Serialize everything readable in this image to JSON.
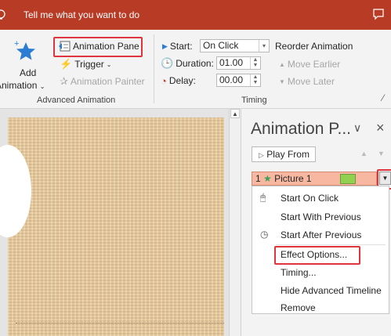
{
  "titlebar": {
    "tell_me": "Tell me what you want to do"
  },
  "ribbon": {
    "add_animation": {
      "line1": "Add",
      "line2": "Animation"
    },
    "animation_pane_label": "Animation Pane",
    "trigger_label": "Trigger",
    "animation_painter_label": "Animation Painter",
    "advanced_group_label": "Advanced Animation",
    "start_label": "Start:",
    "start_value": "On Click",
    "duration_label": "Duration:",
    "duration_value": "01.00",
    "delay_label": "Delay:",
    "delay_value": "00.00",
    "timing_group_label": "Timing",
    "reorder_label": "Reorder Animation",
    "move_earlier_label": "Move Earlier",
    "move_later_label": "Move Later"
  },
  "pane": {
    "title": "Animation P...",
    "play_from_label": "Play From",
    "item": {
      "number": "1",
      "name": "Picture 1"
    }
  },
  "menu": {
    "start_on_click": "Start On Click",
    "start_with_previous": "Start With Previous",
    "start_after_previous": "Start After Previous",
    "effect_options": "Effect Options...",
    "timing": "Timing...",
    "hide_advanced_timeline": "Hide Advanced Timeline",
    "remove": "Remove"
  },
  "colors": {
    "title_bar": "#b83b26",
    "highlight_box": "#e0353d",
    "selected_item": "#f8b7a0",
    "effect_swatch": "#92d050",
    "slide_background": "#e6c99a"
  }
}
